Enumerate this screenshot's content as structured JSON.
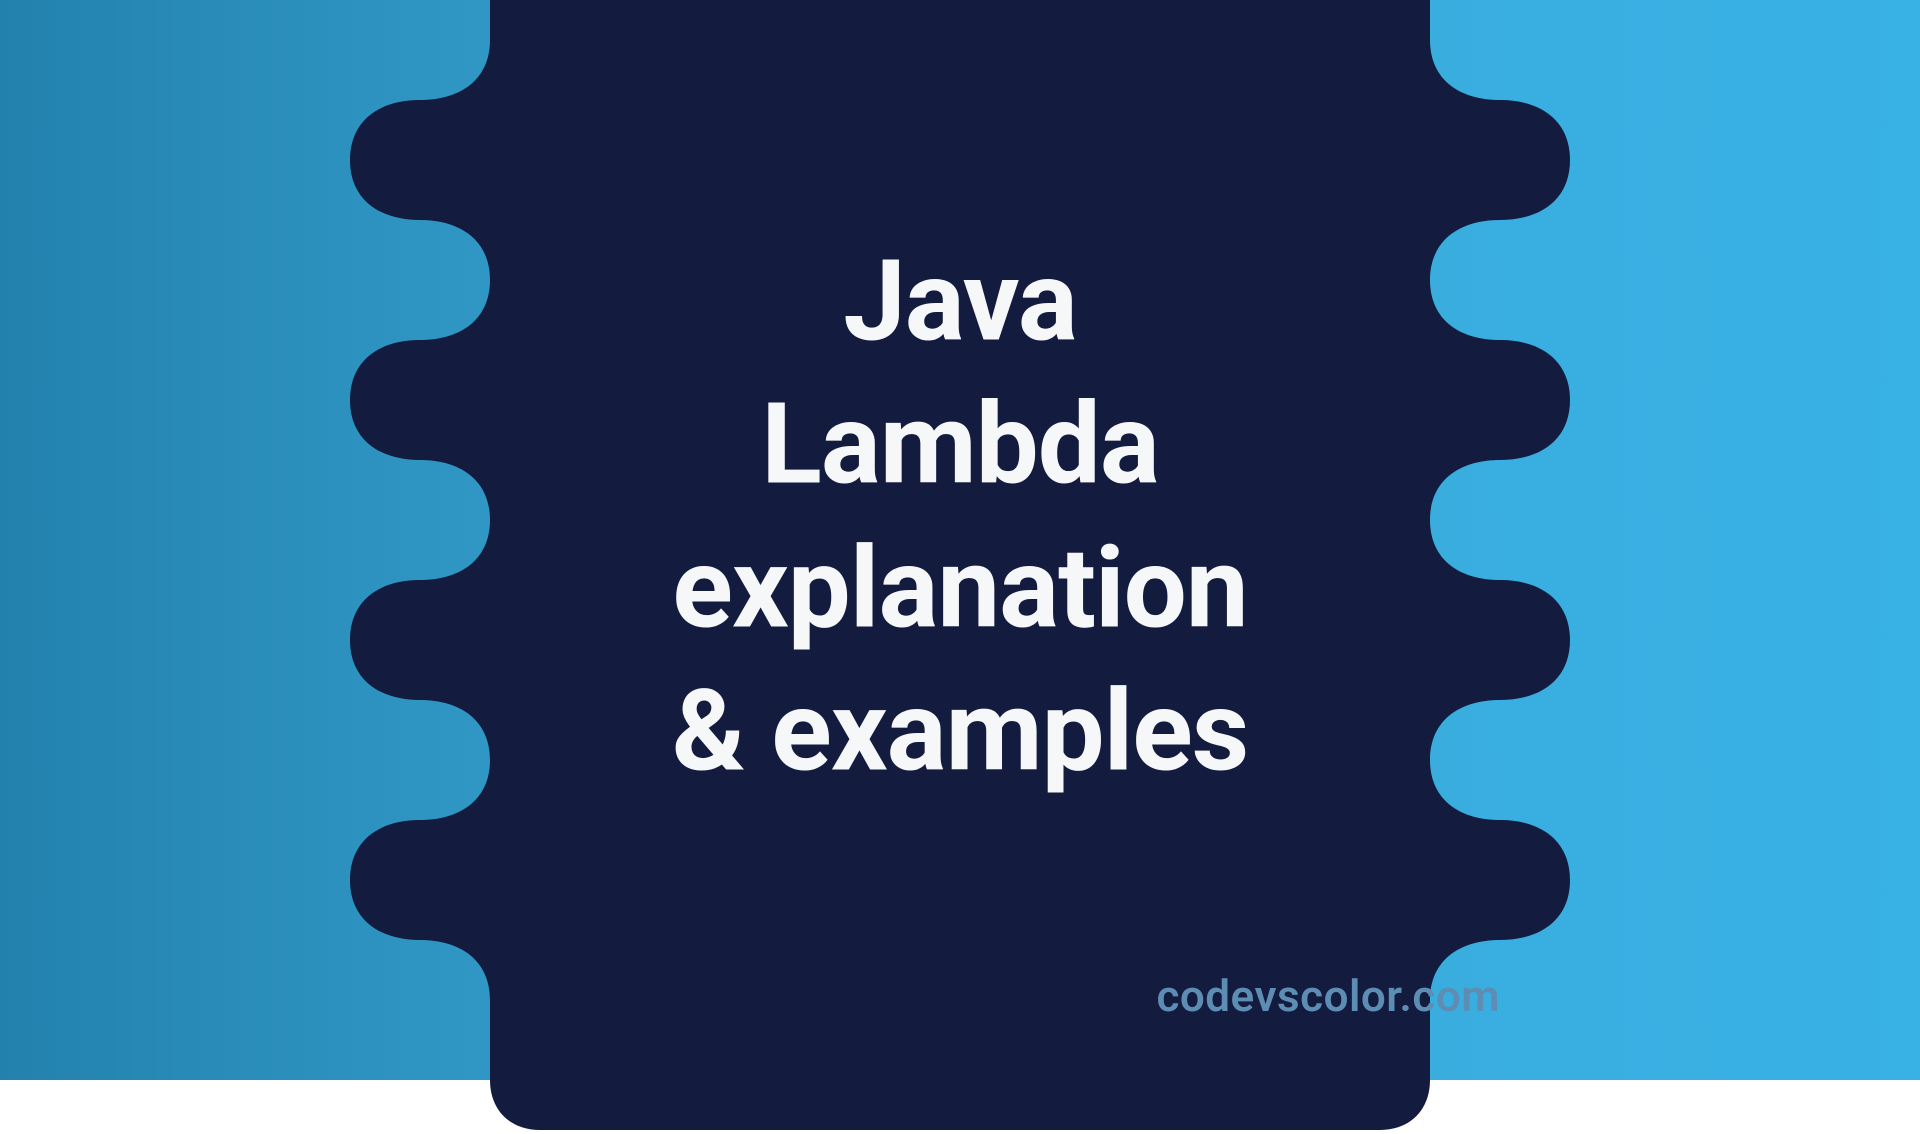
{
  "title": {
    "line1": "Java",
    "line2": "Lambda",
    "line3": "explanation",
    "line4": "& examples"
  },
  "site_label": "codevscolor.com",
  "colors": {
    "blob_fill": "#131B3F",
    "text": "#F6F7F9",
    "label": "#5E8DB3",
    "bg_left": "#2381AD",
    "bg_right": "#38B1E5"
  }
}
